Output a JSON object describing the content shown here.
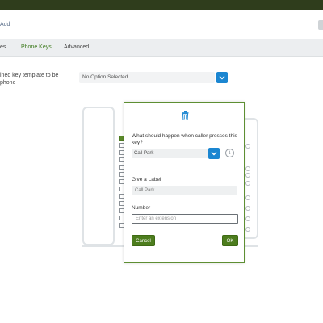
{
  "header": {
    "title_fragment": "Add"
  },
  "tabs": [
    {
      "label": "es",
      "active": false
    },
    {
      "label": "Phone Keys",
      "active": true
    },
    {
      "label": "Advanced",
      "active": false
    }
  ],
  "template": {
    "label": "ined key template to be\nphone",
    "select_value": "No Option Selected"
  },
  "modal": {
    "question": "What should happen when caller presses this key?",
    "action_value": "Call Park",
    "label_heading": "Give a Label",
    "label_placeholder": "Call Park",
    "number_heading": "Number",
    "number_placeholder": "Enter an extension",
    "cancel_label": "Cancel",
    "ok_label": "OK"
  },
  "colors": {
    "accent_green": "#4d7d1e",
    "accent_blue": "#1b86d1",
    "topbar": "#2f3d1c"
  }
}
